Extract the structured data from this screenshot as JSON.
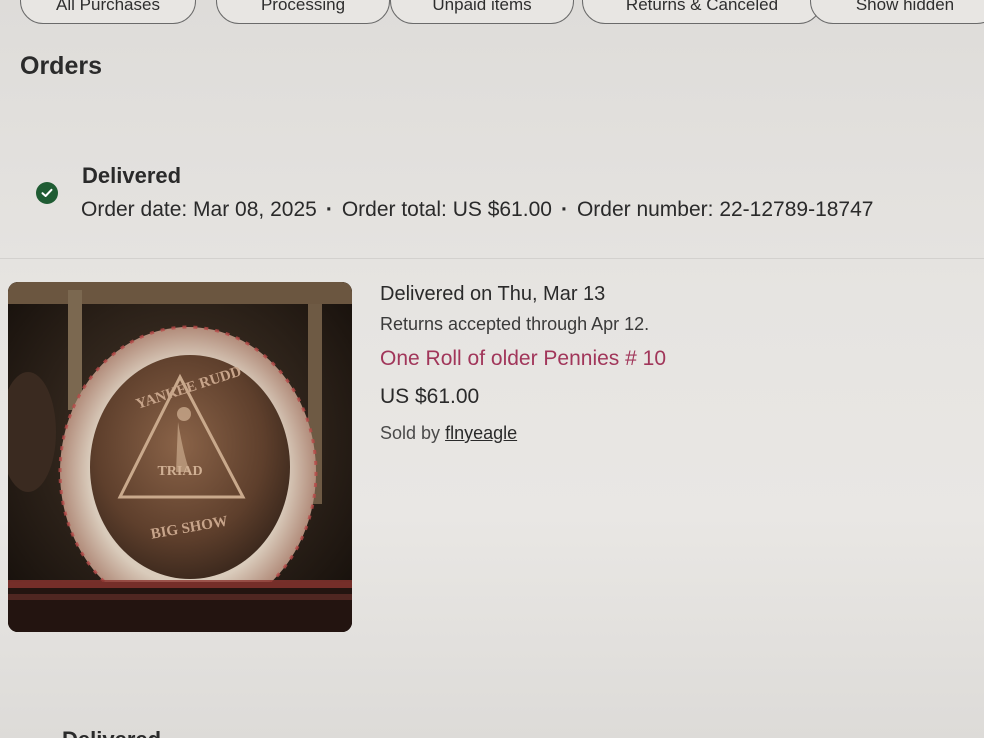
{
  "tabs": [
    {
      "label": "All Purchases"
    },
    {
      "label": "Processing"
    },
    {
      "label": "Unpaid items"
    },
    {
      "label": "Returns & Canceled"
    },
    {
      "label": "Show hidden"
    }
  ],
  "page_title": "Orders",
  "order": {
    "status": "Delivered",
    "status_icon": "check-circle-icon",
    "status_color": "#1f5c33",
    "order_date": "Order date: Mar 08, 2025",
    "order_total": "Order total: US $61.00",
    "order_number": "Order number: 22-12789-18747",
    "separator": "·",
    "item": {
      "delivered_on": "Delivered on Thu, Mar 13",
      "returns_note": "Returns accepted through Apr 12.",
      "title": "One Roll of older Pennies # 10",
      "price": "US $61.00",
      "sold_by_label": "Sold by",
      "seller": "flnyeagle",
      "image_coin_text_top": "YANKEE RUDD",
      "image_coin_text_mid": "TRIAD",
      "image_coin_text_bottom": "BIG SHOW"
    }
  },
  "next_order_status": "Delivered",
  "colors": {
    "link_title": "#a1365a",
    "text": "#2a2a2a"
  }
}
